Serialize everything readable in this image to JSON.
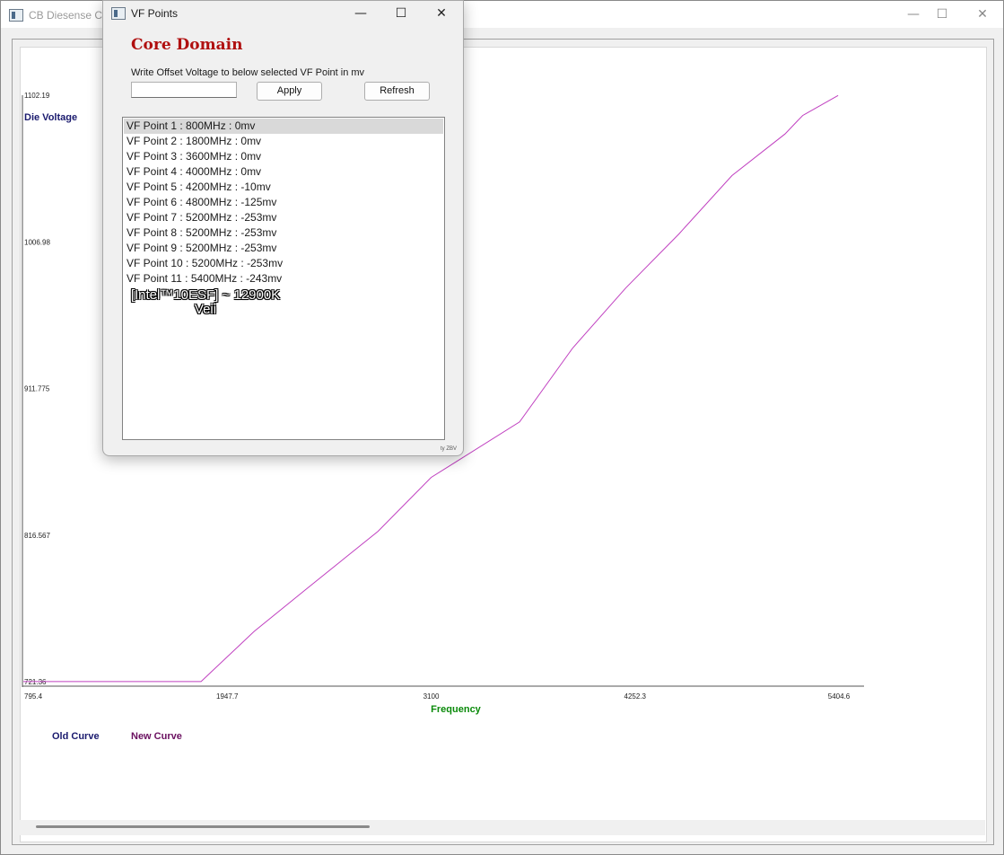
{
  "main_window": {
    "title": "CB Diesense Cu",
    "controls": {
      "minimize": "—",
      "maximize": "☐",
      "close": "✕"
    }
  },
  "dialog": {
    "title": "VF Points",
    "controls": {
      "minimize": "—",
      "maximize": "☐",
      "close": "✕"
    },
    "domain_title": "Core Domain",
    "instruction": "Write Offset Voltage to below selected VF Point in mv",
    "offset_input": {
      "value": "",
      "placeholder": ""
    },
    "apply_label": "Apply",
    "refresh_label": "Refresh",
    "vf_points": [
      {
        "label": "VF Point 1 : 800MHz : 0mv",
        "selected": true
      },
      {
        "label": "VF Point 2 : 1800MHz : 0mv",
        "selected": false
      },
      {
        "label": "VF Point 3 : 3600MHz : 0mv",
        "selected": false
      },
      {
        "label": "VF Point 4 : 4000MHz : 0mv",
        "selected": false
      },
      {
        "label": "VF Point 5 : 4200MHz : -10mv",
        "selected": false
      },
      {
        "label": "VF Point 6 : 4800MHz : -125mv",
        "selected": false
      },
      {
        "label": "VF Point 7 : 5200MHz : -253mv",
        "selected": false
      },
      {
        "label": "VF Point 8 : 5200MHz : -253mv",
        "selected": false
      },
      {
        "label": "VF Point 9 : 5200MHz : -253mv",
        "selected": false
      },
      {
        "label": "VF Point 10 : 5200MHz : -253mv",
        "selected": false
      },
      {
        "label": "VF Point 11 : 5400MHz : -243mv",
        "selected": false
      }
    ],
    "watermark_line1": "[Intel™10ESF] ~ 12900K",
    "watermark_line2": "Veii",
    "credit": "ty ZBV"
  },
  "chart_data": {
    "type": "line",
    "ylabel": "Die Voltage",
    "xlabel": "Frequency",
    "xlim": [
      795.4,
      5404.6
    ],
    "ylim": [
      721.36,
      1102.19
    ],
    "x_ticks": [
      "795.4",
      "1947.7",
      "3100",
      "4252.3",
      "5404.6"
    ],
    "y_ticks": [
      "1102.19",
      "1006.98",
      "911.775",
      "816.567",
      "721.36"
    ],
    "legend": [
      "Old Curve",
      "New Curve"
    ],
    "legend_position": "bottom-left",
    "colors": {
      "old": "#1a1a6e",
      "new": "#6b1060",
      "line": "#c040c0",
      "xlabel": "#0a8a0a",
      "ylabel": "#1a1a6e",
      "domain_title": "#b01010"
    },
    "series": [
      {
        "name": "New Curve",
        "x": [
          795.4,
          1800,
          2100,
          2400,
          2800,
          3100,
          3600,
          3900,
          4200,
          4500,
          4800,
          5100,
          5200,
          5400
        ],
        "y": [
          721.4,
          721.4,
          754,
          782,
          819,
          854,
          890,
          938,
          977,
          1012,
          1050,
          1077,
          1089,
          1102
        ]
      }
    ]
  }
}
